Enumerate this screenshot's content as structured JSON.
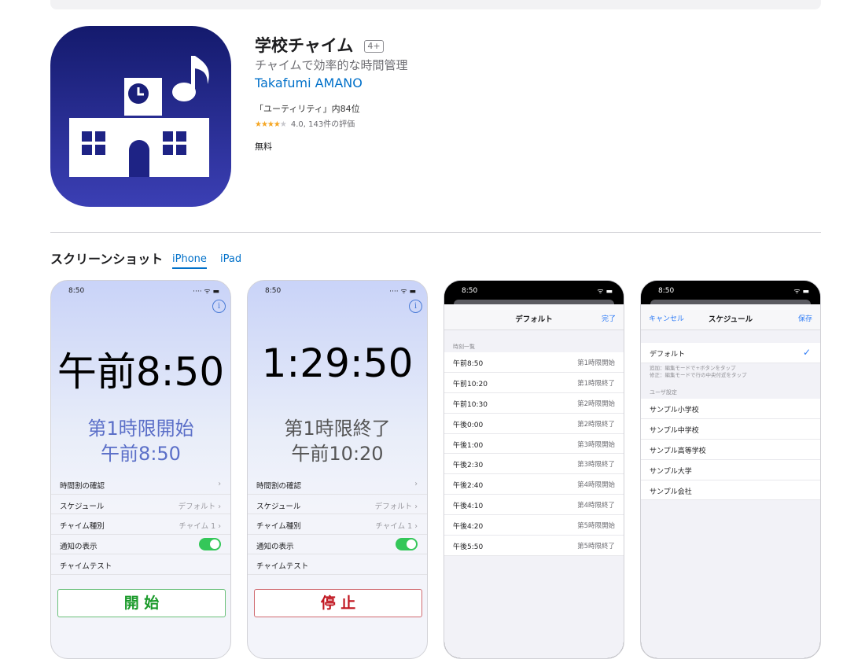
{
  "app": {
    "title": "学校チャイム",
    "age_rating": "4+",
    "subtitle": "チャイムで効率的な時間管理",
    "developer": "Takafumi AMANO",
    "rank": "「ユーティリティ」内84位",
    "rating_value": "4.0",
    "rating_count": "143件の評価",
    "stars": 4,
    "price": "無料"
  },
  "screenshots": {
    "heading": "スクリーンショット",
    "tabs": [
      "iPhone",
      "iPad"
    ],
    "active_tab": "iPhone"
  },
  "shot1": {
    "status_time": "8:50",
    "status_icons": "···· ᯤ ▬",
    "info": "i",
    "clock": "午前8:50",
    "period_line1": "第1時限開始",
    "period_line2": "午前8:50",
    "menu": [
      {
        "label": "時間割の確認",
        "value": "›"
      },
      {
        "label": "スケジュール",
        "value": "デフォルト ›"
      },
      {
        "label": "チャイム種別",
        "value": "チャイム 1 ›"
      },
      {
        "label": "通知の表示",
        "toggle": true
      },
      {
        "label": "チャイムテスト"
      }
    ],
    "button": "開 始"
  },
  "shot2": {
    "status_time": "8:50",
    "status_icons": "···· ᯤ ▬",
    "info": "i",
    "clock": "1:29:50",
    "period_line1": "第1時限終了",
    "period_line2": "午前10:20",
    "menu": [
      {
        "label": "時間割の確認",
        "value": "›"
      },
      {
        "label": "スケジュール",
        "value": "デフォルト ›"
      },
      {
        "label": "チャイム種別",
        "value": "チャイム 1 ›"
      },
      {
        "label": "通知の表示",
        "toggle": true
      },
      {
        "label": "チャイムテスト"
      }
    ],
    "button": "停 止"
  },
  "shot3": {
    "status_time": "8:50",
    "status_icons": "ᯤ ▬",
    "nav_title": "デフォルト",
    "nav_right": "完了",
    "section": "時刻一覧",
    "items": [
      {
        "time": "午前8:50",
        "event": "第1時限開始"
      },
      {
        "time": "午前10:20",
        "event": "第1時限終了"
      },
      {
        "time": "午前10:30",
        "event": "第2時限開始"
      },
      {
        "time": "午後0:00",
        "event": "第2時限終了"
      },
      {
        "time": "午後1:00",
        "event": "第3時限開始"
      },
      {
        "time": "午後2:30",
        "event": "第3時限終了"
      },
      {
        "time": "午後2:40",
        "event": "第4時限開始"
      },
      {
        "time": "午後4:10",
        "event": "第4時限終了"
      },
      {
        "time": "午後4:20",
        "event": "第5時限開始"
      },
      {
        "time": "午後5:50",
        "event": "第5時限終了"
      }
    ]
  },
  "shot4": {
    "status_time": "8:50",
    "status_icons": "ᯤ ▬",
    "nav_left": "キャンセル",
    "nav_title": "スケジュール",
    "nav_right": "保存",
    "default_item": "デフォルト",
    "check": "✓",
    "note_line1": "追加：編集モードで+ボタンをタップ",
    "note_line2": "修正：編集モードで行の中央付近をタップ",
    "section": "ユーザ設定",
    "items": [
      "サンプル小学校",
      "サンプル中学校",
      "サンプル高等学校",
      "サンプル大学",
      "サンプル会社"
    ]
  }
}
